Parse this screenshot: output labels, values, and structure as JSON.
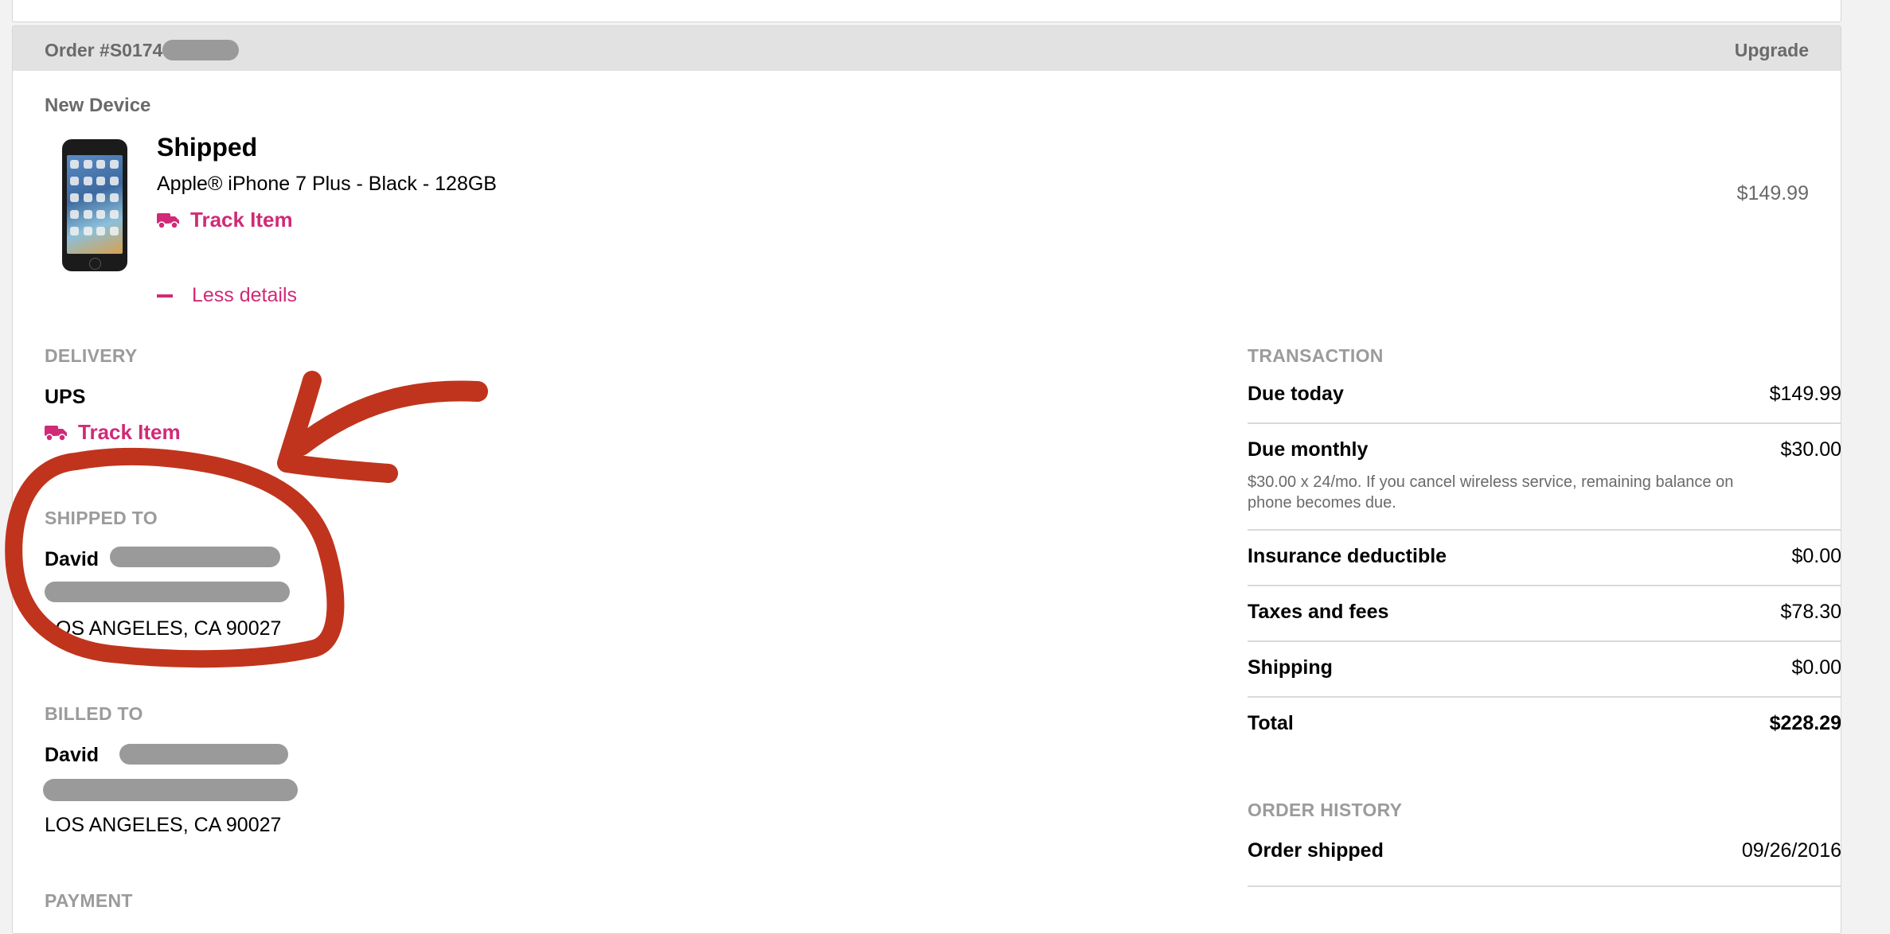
{
  "order": {
    "number_prefix": "Order #S0174",
    "type": "Upgrade"
  },
  "device": {
    "section_title": "New Device",
    "status": "Shipped",
    "name": "Apple® iPhone 7 Plus - Black - 128GB",
    "track_label": "Track Item",
    "price": "$149.99",
    "less_details": "Less details"
  },
  "delivery": {
    "title": "DELIVERY",
    "carrier": "UPS",
    "track_label": "Track Item"
  },
  "shipped_to": {
    "title": "SHIPPED TO",
    "first_name": "David",
    "city_line": "LOS ANGELES, CA 90027"
  },
  "billed_to": {
    "title": "BILLED TO",
    "first_name": "David",
    "city_line": "LOS ANGELES, CA 90027"
  },
  "payment": {
    "title": "PAYMENT"
  },
  "transaction": {
    "title": "TRANSACTION",
    "rows": [
      {
        "label": "Due today",
        "value": "$149.99"
      },
      {
        "label": "Due monthly",
        "value": "$30.00",
        "note": "$30.00 x 24/mo. If you cancel wireless service, remaining balance on phone becomes due."
      },
      {
        "label": "Insurance deductible",
        "value": "$0.00"
      },
      {
        "label": "Taxes and fees",
        "value": "$78.30"
      },
      {
        "label": "Shipping",
        "value": "$0.00"
      },
      {
        "label": "Total",
        "value": "$228.29"
      }
    ]
  },
  "order_history": {
    "title": "ORDER HISTORY",
    "rows": [
      {
        "label": "Order shipped",
        "value": "09/26/2016"
      }
    ]
  },
  "colors": {
    "accent_pink": "#d12a77",
    "annotation_red": "#c0341d",
    "header_gray": "#e2e2e2",
    "label_gray": "#9b9b9b"
  }
}
